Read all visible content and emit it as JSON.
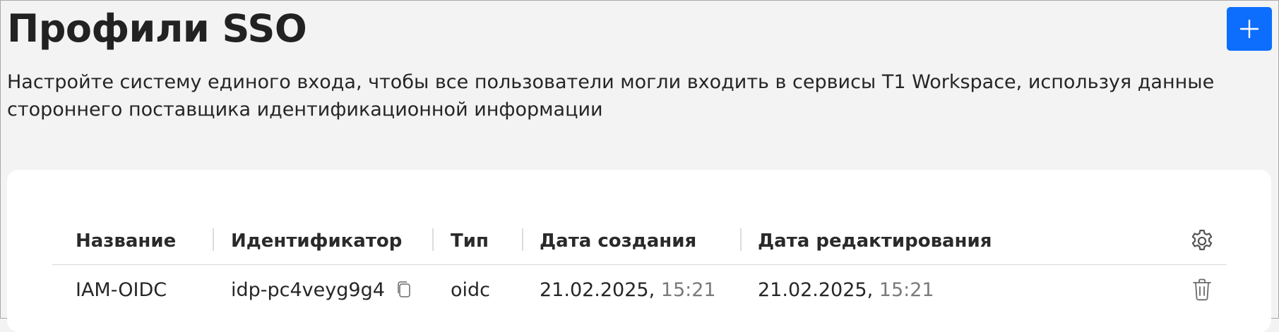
{
  "page": {
    "title": "Профили SSO",
    "description": "Настройте систему единого входа, чтобы все пользователи могли входить в сервисы T1 Workspace, используя данные стороннего поставщика идентификационной информации",
    "add_icon": "plus-icon",
    "accent_color": "#0d6efd"
  },
  "table": {
    "columns": [
      {
        "label": "Название"
      },
      {
        "label": "Идентификатор"
      },
      {
        "label": "Тип"
      },
      {
        "label": "Дата создания"
      },
      {
        "label": "Дата редактирования"
      }
    ],
    "settings_icon": "gear-icon",
    "rows": [
      {
        "name": "IAM-OIDC",
        "id": "idp-pc4veyg9g4",
        "copy_icon": "copy-icon",
        "type": "oidc",
        "created_date": "21.02.2025,",
        "created_time": "15:21",
        "edited_date": "21.02.2025,",
        "edited_time": "15:21",
        "delete_icon": "trash-icon"
      }
    ]
  }
}
